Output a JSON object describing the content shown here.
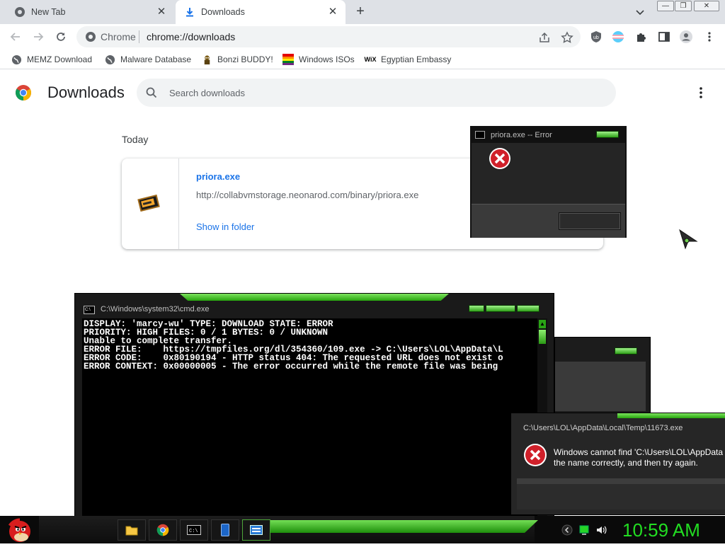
{
  "browser": {
    "tabs": [
      {
        "label": "New Tab",
        "icon": "chrome-icon",
        "active": false
      },
      {
        "label": "Downloads",
        "icon": "download-icon",
        "active": true
      }
    ],
    "omnibox": {
      "scheme": "Chrome",
      "url": "chrome://downloads"
    },
    "bookmarks": [
      {
        "label": "MEMZ Download",
        "icon": "globe-icon"
      },
      {
        "label": "Malware Database",
        "icon": "globe-icon"
      },
      {
        "label": "Bonzi BUDDY!",
        "icon": "bonzi-icon"
      },
      {
        "label": "Windows ISOs",
        "icon": "windows-flag-icon"
      },
      {
        "label": "Egyptian Embassy",
        "icon": "wix-icon"
      }
    ],
    "window_buttons": {
      "minimize": "—",
      "restore": "❐",
      "close": "✕"
    }
  },
  "downloads": {
    "title": "Downloads",
    "search_placeholder": "Search downloads",
    "section": "Today",
    "items": [
      {
        "filename": "priora.exe",
        "url": "http://collabvmstorage.neonarod.com/binary/priora.exe",
        "action": "Show in folder"
      }
    ]
  },
  "error_dialog": {
    "title": "priora.exe -- Error"
  },
  "cmd_window": {
    "title": "C:\\Windows\\system32\\cmd.exe",
    "lines": [
      "DISPLAY: 'marcy-wu' TYPE: DOWNLOAD STATE: ERROR",
      "PRIORITY: HIGH FILES: 0 / 1 BYTES: 0 / UNKNOWN",
      "Unable to complete transfer.",
      "ERROR FILE:    https://tmpfiles.org/dl/354360/109.exe -> C:\\Users\\LOL\\AppData\\L",
      "ERROR CODE:    0x80190194 - HTTP status 404: The requested URL does not exist o",
      "ERROR CONTEXT: 0x00000005 - The error occurred while the remote file was being"
    ]
  },
  "exe_dialog": {
    "title": "C:\\Users\\LOL\\AppData\\Local\\Temp\\11673.exe",
    "message_line1": "Windows cannot find 'C:\\Users\\LOL\\AppData",
    "message_line2": "the name correctly, and then try again."
  },
  "taskbar": {
    "clock": "10:59 AM",
    "buttons": [
      "folder-icon",
      "chrome-icon",
      "cmd-icon",
      "phone-icon",
      "window-icon"
    ]
  },
  "colors": {
    "accent_green": "#22dd22",
    "link_blue": "#1a73e8"
  }
}
